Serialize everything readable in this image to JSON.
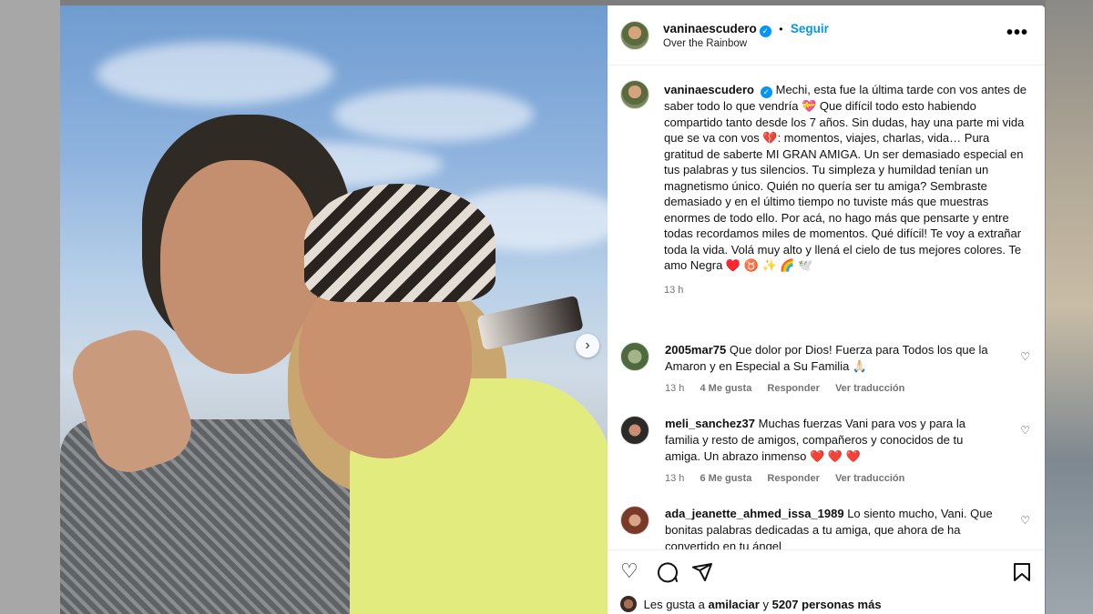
{
  "post": {
    "author": "vaninaescudero",
    "follow_label": "Seguir",
    "location": "Over the Rainbow",
    "more_icon": "•••"
  },
  "caption": {
    "author": "vaninaescudero",
    "text": "Mechi, esta fue la última tarde con vos antes de saber todo lo que vendría 💝 Que difícil todo esto habiendo compartido tanto desde los 7 años. Sin dudas, hay una parte mi vida que se va con vos 💔: momentos, viajes, charlas, vida… Pura gratitud de saberte MI GRAN AMIGA. Un ser demasiado especial en tus palabras y tus silencios. Tu simpleza y humildad tenían un magnetismo único. Quién no quería ser tu amiga? Sembraste demasiado y en el último tiempo no tuviste más que muestras enormes de todo ello. Por acá, no hago más que pensarte y entre todas recordamos miles de momentos. Qué difícil! Te voy a extrañar toda la vida. Volá muy alto y llená el cielo de tus mejores colores. Te amo Negra ♥️ ♉ ✨ 🌈 🕊️",
    "time": "13 h"
  },
  "comments": [
    {
      "user": "2005mar75",
      "text": "Que dolor por Dios! Fuerza para Todos los que la Amaron y en Especial a Su Familia 🙏🏻",
      "time": "13 h",
      "likes": "4 Me gusta",
      "reply": "Responder",
      "translate": "Ver traducción"
    },
    {
      "user": "meli_sanchez37",
      "text": "Muchas fuerzas Vani para vos y para la familia y resto de amigos, compañeros y conocidos de tu amiga. Un abrazo inmenso ❤️ ❤️ ❤️",
      "time": "13 h",
      "likes": "6 Me gusta",
      "reply": "Responder",
      "translate": "Ver traducción"
    },
    {
      "user": "ada_jeanette_ahmed_issa_1989",
      "text": "Lo siento mucho, Vani. Que bonitas palabras dedicadas a tu amiga, que ahora de ha convertido en tu ángel",
      "time": "",
      "likes": "",
      "reply": "",
      "translate": ""
    }
  ],
  "likes": {
    "prefix": "Les gusta a",
    "user": "amilaciar",
    "joiner": "y",
    "count": "5207 personas más"
  },
  "colors": {
    "accent": "#0095f6",
    "secondary_text": "#737373"
  },
  "icons": {
    "heart": "heart-icon",
    "comment": "comment-icon",
    "share": "share-icon",
    "save": "bookmark-icon",
    "next": "chevron-right-icon"
  }
}
